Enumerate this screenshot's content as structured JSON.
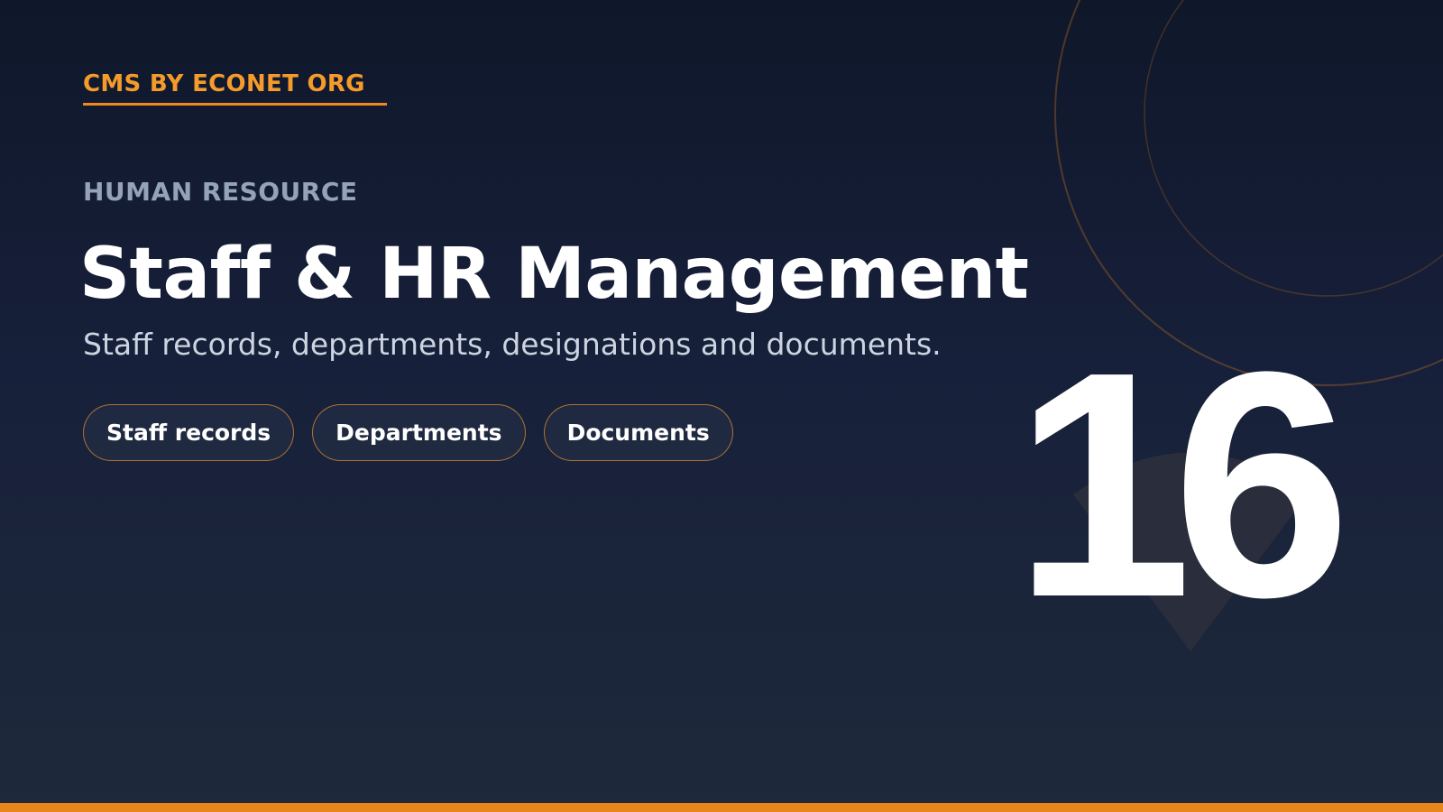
{
  "brand": {
    "text": "CMS BY ECONET ORG",
    "color": "#f49b2b"
  },
  "section": {
    "label": "HUMAN RESOURCE"
  },
  "hero": {
    "title": "Staff & HR Management",
    "subtitle": "Staff records, departments, designations and documents."
  },
  "chips": [
    {
      "label": "Staff records"
    },
    {
      "label": "Departments"
    },
    {
      "label": "Documents"
    }
  ],
  "slide_number": "16",
  "colors": {
    "background_top": "#0f172a",
    "background_bottom": "#1e293b",
    "accent": "#e8861c"
  }
}
